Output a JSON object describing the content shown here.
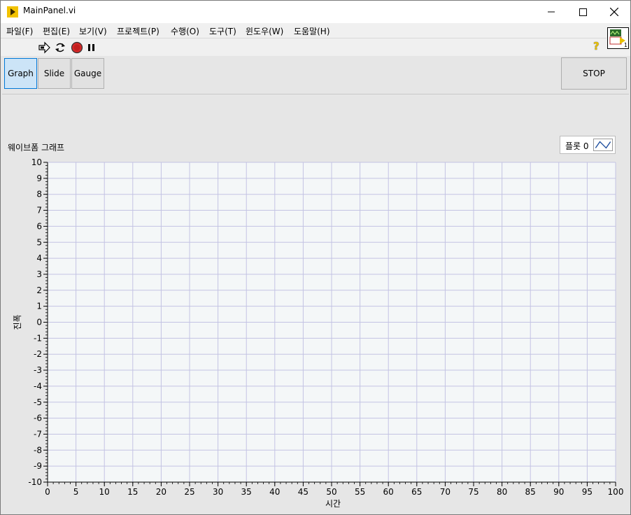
{
  "window": {
    "title": "MainPanel.vi",
    "controls": {
      "minimize": "minimize",
      "maximize": "maximize",
      "close": "close"
    }
  },
  "menu": [
    "파일(F)",
    "편집(E)",
    "보기(V)",
    "프로젝트(P)",
    "수행(O)",
    "도구(T)",
    "윈도우(W)",
    "도움말(H)"
  ],
  "toolbar": {
    "tools": [
      "run-arrow-icon",
      "run-continuous-icon",
      "abort-icon",
      "pause-icon"
    ],
    "help": "?"
  },
  "vi_icon_badge": "1",
  "tabs": [
    {
      "label": "Graph",
      "active": true
    },
    {
      "label": "Slide",
      "active": false
    },
    {
      "label": "Gauge",
      "active": false
    }
  ],
  "stop_button": "STOP",
  "graph": {
    "label": "웨이브폼 그래프",
    "legend": "플롯 0"
  },
  "chart_data": {
    "type": "line",
    "title": "웨이브폼 그래프",
    "xlabel": "시간",
    "ylabel": "진폭",
    "xlim": [
      0,
      100
    ],
    "ylim": [
      -10,
      10
    ],
    "x_ticks": [
      0,
      5,
      10,
      15,
      20,
      25,
      30,
      35,
      40,
      45,
      50,
      55,
      60,
      65,
      70,
      75,
      80,
      85,
      90,
      95,
      100
    ],
    "y_ticks": [
      10,
      9,
      8,
      7,
      6,
      5,
      4,
      3,
      2,
      1,
      0,
      -1,
      -2,
      -3,
      -4,
      -5,
      -6,
      -7,
      -8,
      -9,
      -10
    ],
    "grid": true,
    "legend_position": "top-right",
    "series": [
      {
        "name": "플롯 0",
        "values": []
      }
    ],
    "colors": {
      "plot_bg": "#f4f7f8",
      "grid": "#c3c3e3",
      "axis": "#000000"
    }
  }
}
